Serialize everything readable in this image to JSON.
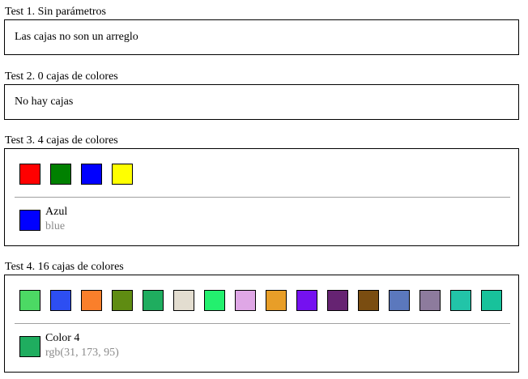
{
  "tests": [
    {
      "title": "Test 1. Sin parámetros",
      "message": "Las cajas no son un arreglo"
    },
    {
      "title": "Test 2. 0 cajas de colores",
      "message": "No hay cajas"
    },
    {
      "title": "Test 3. 4 cajas de colores",
      "swatches": [
        "#ff0000",
        "#008000",
        "#0000ff",
        "#ffff00"
      ],
      "selected": {
        "name": "Azul",
        "value": "blue",
        "color": "#0000ff"
      }
    },
    {
      "title": "Test 4. 16 cajas de colores",
      "swatches": [
        "#4cd964",
        "#2d4ef2",
        "#fa7f2b",
        "#5f8c12",
        "#1fad5f",
        "#e3ddd0",
        "#23f06e",
        "#dfa7e6",
        "#e89e28",
        "#7511f0",
        "#662372",
        "#7a4d11",
        "#5b78bd",
        "#8d7b9d",
        "#22c4a8",
        "#18c29b"
      ],
      "selected": {
        "name": "Color 4",
        "value": "rgb(31, 173, 95)",
        "color": "#1fad5f"
      }
    }
  ]
}
